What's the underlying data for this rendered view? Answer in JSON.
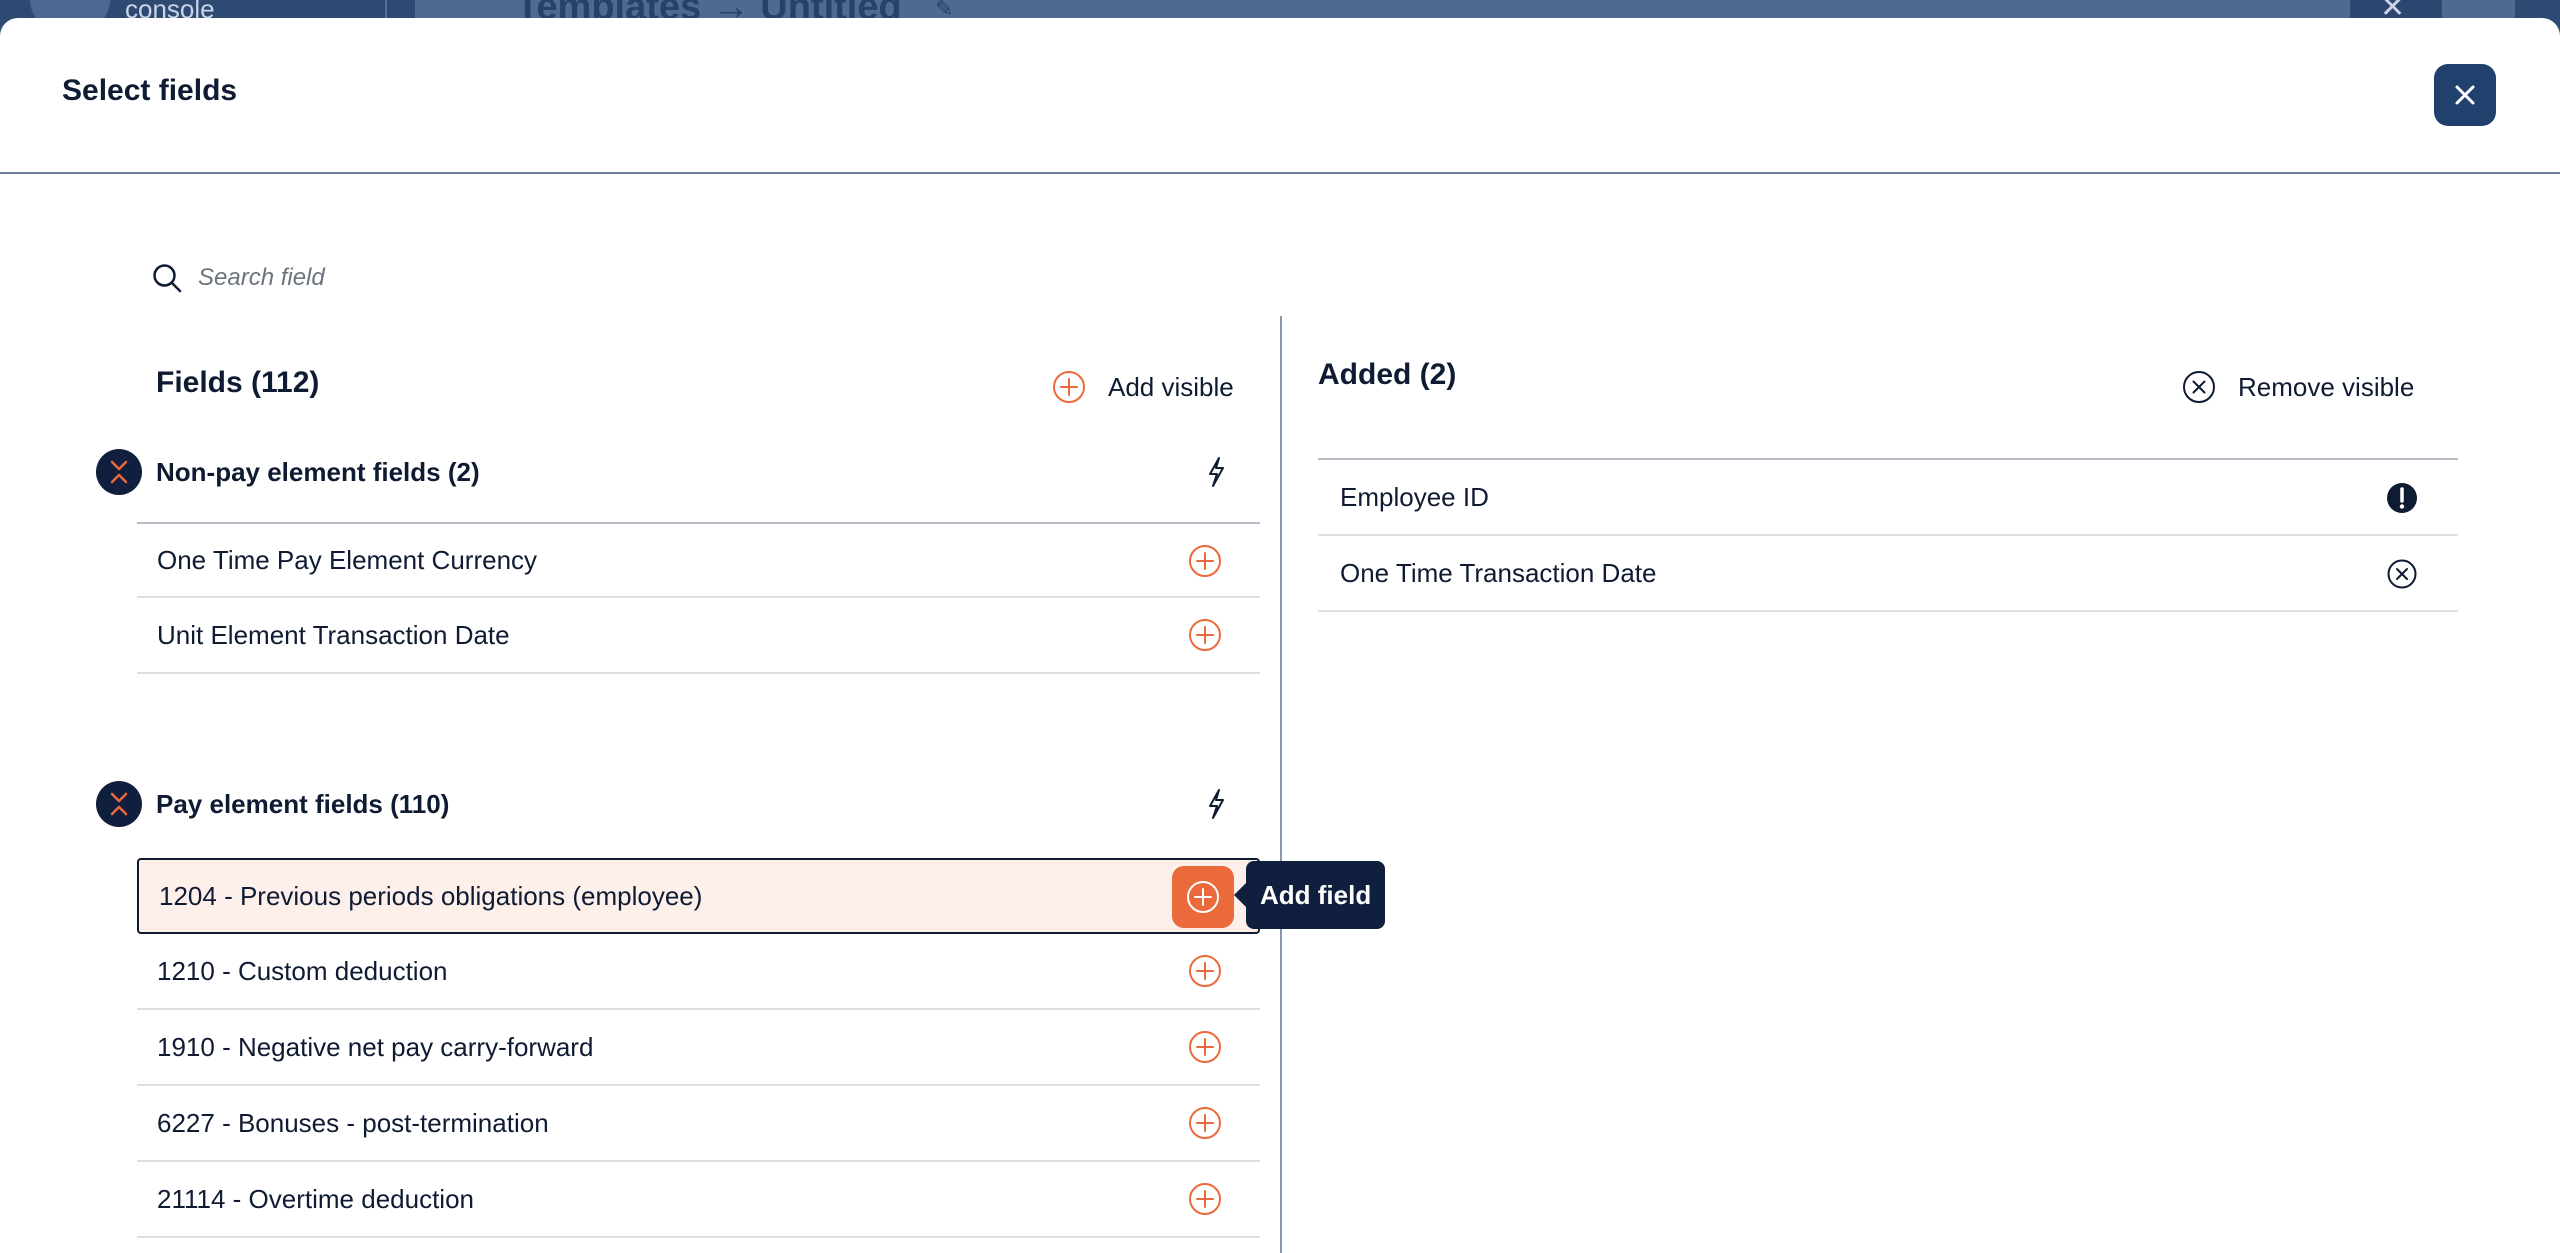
{
  "background": {
    "app_name": "console",
    "page_title": "Templates → Untitled"
  },
  "modal": {
    "title": "Select fields",
    "close_icon": "close-icon"
  },
  "search": {
    "placeholder": "Search field",
    "icon": "search-icon"
  },
  "fields_panel": {
    "title": "Fields (112)",
    "add_visible_label": "Add visible",
    "groups": [
      {
        "title": "Non-pay element fields (2)",
        "items": [
          "One Time Pay Element Currency",
          "Unit Element Transaction Date"
        ]
      },
      {
        "title": "Pay element fields (110)",
        "items": [
          "1204 - Previous periods obligations (employee)",
          "1210 - Custom deduction",
          "1910 - Negative net pay carry-forward",
          "6227 - Bonuses - post-termination",
          "21114 - Overtime deduction"
        ]
      }
    ],
    "tooltip": "Add field"
  },
  "added_panel": {
    "title": "Added (2)",
    "remove_visible_label": "Remove visible",
    "items": [
      {
        "label": "Employee ID",
        "status_icon": "required-alert-icon"
      },
      {
        "label": "One Time Transaction Date",
        "status_icon": "remove-circle-icon"
      }
    ]
  },
  "colors": {
    "accent": "#ea6a3b",
    "navy": "#0f1f3d",
    "close_button": "#20406e",
    "active_row_bg": "#fdf0eb"
  }
}
